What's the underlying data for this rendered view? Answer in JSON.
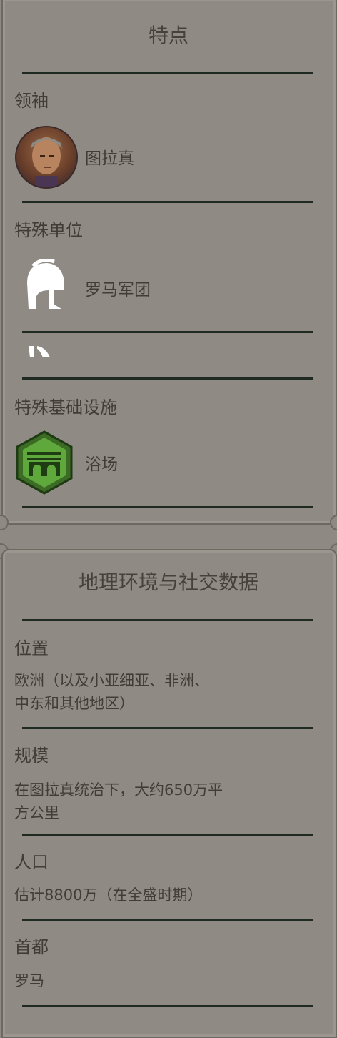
{
  "traits": {
    "title": "特点",
    "leader": {
      "heading": "领袖",
      "name": "图拉真"
    },
    "unit": {
      "heading": "特殊单位",
      "name": "罗马军团"
    },
    "infrastructure": {
      "heading": "特殊基础设施",
      "name": "浴场"
    }
  },
  "geo": {
    "title": "地理环境与社交数据",
    "location": {
      "heading": "位置",
      "line1": "欧洲（以及小亚细亚、非洲、",
      "line2": "中东和其他地区）"
    },
    "size": {
      "heading": "规模",
      "line1": "在图拉真统治下，大约650万平",
      "line2": "方公里"
    },
    "population": {
      "heading": "人口",
      "value": "估计8800万（在全盛时期）"
    },
    "capital": {
      "heading": "首都",
      "value": "罗马"
    }
  },
  "colors": {
    "divider": "#1f2a23",
    "hex_green": "#5fa83b"
  },
  "icons": [
    "leader-portrait",
    "helmet-icon",
    "bath-building-icon"
  ]
}
